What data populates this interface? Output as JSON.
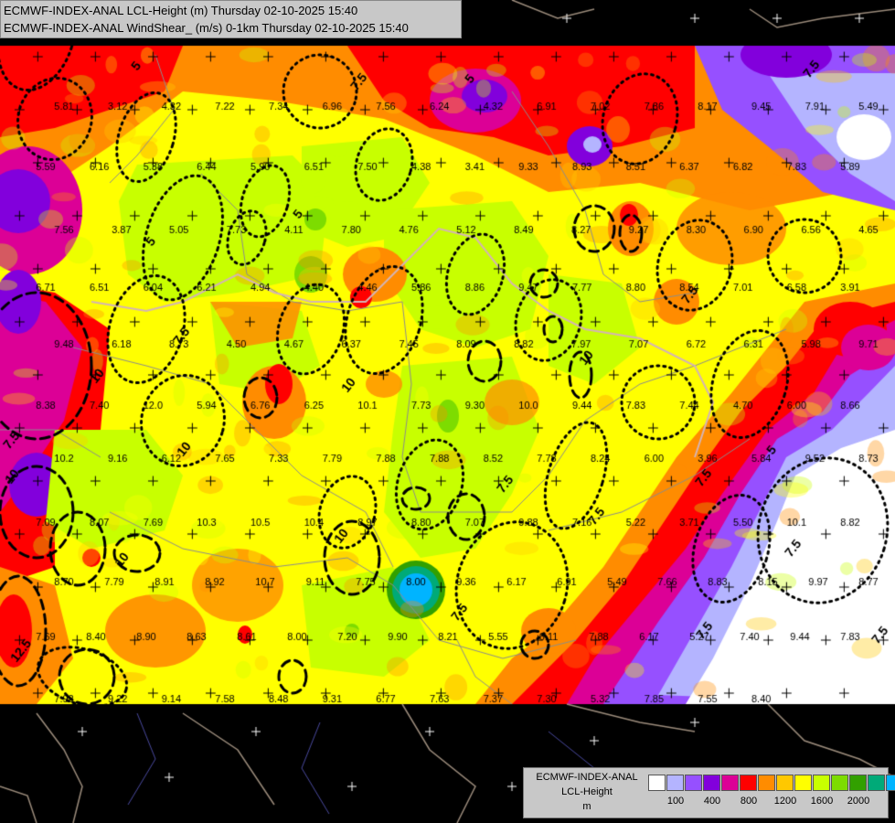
{
  "header": {
    "line1": "ECMWF-INDEX-ANAL LCL-Height (m) Thursday 02-10-2025 15:40",
    "line2": "ECMWF-INDEX-ANAL WindShear_ (m/s) 0-1km Thursday 02-10-2025 15:40"
  },
  "legend": {
    "line1": "ECMWF-INDEX-ANAL",
    "line2": "LCL-Height",
    "unit": "m",
    "colors": [
      "#ffffff",
      "#b4b4ff",
      "#9650ff",
      "#8200dc",
      "#dc0096",
      "#ff0000",
      "#ff8c00",
      "#ffc800",
      "#ffff00",
      "#c8ff00",
      "#7ddc00",
      "#32a000",
      "#00aa78",
      "#00b4ff"
    ],
    "ticks": [
      "100",
      "400",
      "800",
      "1200",
      "1600",
      "2000"
    ]
  },
  "palette": {
    "white": "#ffffff",
    "lavender": "#b4b4ff",
    "violet": "#9650ff",
    "purple": "#8200dc",
    "magenta": "#dc0096",
    "red": "#ff0000",
    "orange": "#ff8c00",
    "amber": "#ffc800",
    "yellow": "#ffff00",
    "lime": "#c8ff00",
    "green": "#7ddc00",
    "darkgreen": "#32a000",
    "teal": "#00aa78",
    "cyan": "#00b4ff",
    "background": "#000000"
  },
  "contour_labels": [
    "5",
    "7.5",
    "10",
    "12.5"
  ],
  "station_values": [
    "5.81",
    "3.12",
    "4.32",
    "7.22",
    "7.34",
    "6.96",
    "7.56",
    "6.24",
    "4.32",
    "6.91",
    "7.02",
    "7.86",
    "8.17",
    "9.45",
    "7.91",
    "5.49",
    "5.59",
    "6.16",
    "5.38",
    "6.44",
    "5.90",
    "6.51",
    "7.50",
    "4.38",
    "3.41",
    "9.33",
    "8.93",
    "8.51",
    "6.37",
    "6.82",
    "7.83",
    "5.89",
    "7.56",
    "3.87",
    "5.05",
    "7.73",
    "4.11",
    "7.80",
    "4.76",
    "5.12",
    "8.49",
    "8.27",
    "9.27",
    "8.30",
    "6.90",
    "6.56",
    "4.65",
    "6.71",
    "6.51",
    "6.04",
    "6.21",
    "4.94",
    "4.40",
    "4.46",
    "5.86",
    "8.86",
    "9.47",
    "7.77",
    "8.80",
    "8.54",
    "7.01",
    "6.58",
    "3.91",
    "9.48",
    "6.18",
    "8.73",
    "4.50",
    "4.67",
    "6.37",
    "7.45",
    "8.09",
    "8.82",
    "7.97",
    "7.07",
    "6.72",
    "6.31",
    "5.98",
    "9.71",
    "8.38",
    "7.40",
    "12.0",
    "5.94",
    "6.76",
    "6.25",
    "10.1",
    "7.73",
    "9.30",
    "10.0",
    "9.44",
    "7.83",
    "7.44",
    "4.70",
    "6.00",
    "8.66",
    "10.2",
    "9.16",
    "6.12",
    "7.65",
    "7.33",
    "7.79",
    "7.88",
    "7.88",
    "8.52",
    "7.78",
    "8.24",
    "6.00",
    "3.96",
    "5.84",
    "9.52",
    "8.73",
    "7.09",
    "8.07",
    "7.69",
    "10.3",
    "10.5",
    "10.4",
    "8.97",
    "8.80",
    "7.07",
    "9.88",
    "7.16",
    "5.22",
    "3.71",
    "5.50",
    "10.1",
    "8.82",
    "8.70",
    "7.79",
    "8.91",
    "8.92",
    "10.7",
    "9.11",
    "7.75",
    "8.00",
    "9.36",
    "6.17",
    "6.91",
    "5.49",
    "7.66",
    "8.83",
    "8.15",
    "9.97",
    "8.77",
    "7.69",
    "8.40",
    "8.90",
    "8.63",
    "8.61",
    "8.00",
    "7.20",
    "9.90",
    "8.21",
    "5.55",
    "6.11",
    "7.88",
    "6.17",
    "5.27",
    "7.40",
    "9.44",
    "7.83",
    "7.92",
    "9.22",
    "9.14",
    "7.58",
    "8.48",
    "9.31",
    "6.77",
    "7.63",
    "7.37",
    "7.30",
    "5.32",
    "7.85",
    "7.55",
    "8.40"
  ]
}
